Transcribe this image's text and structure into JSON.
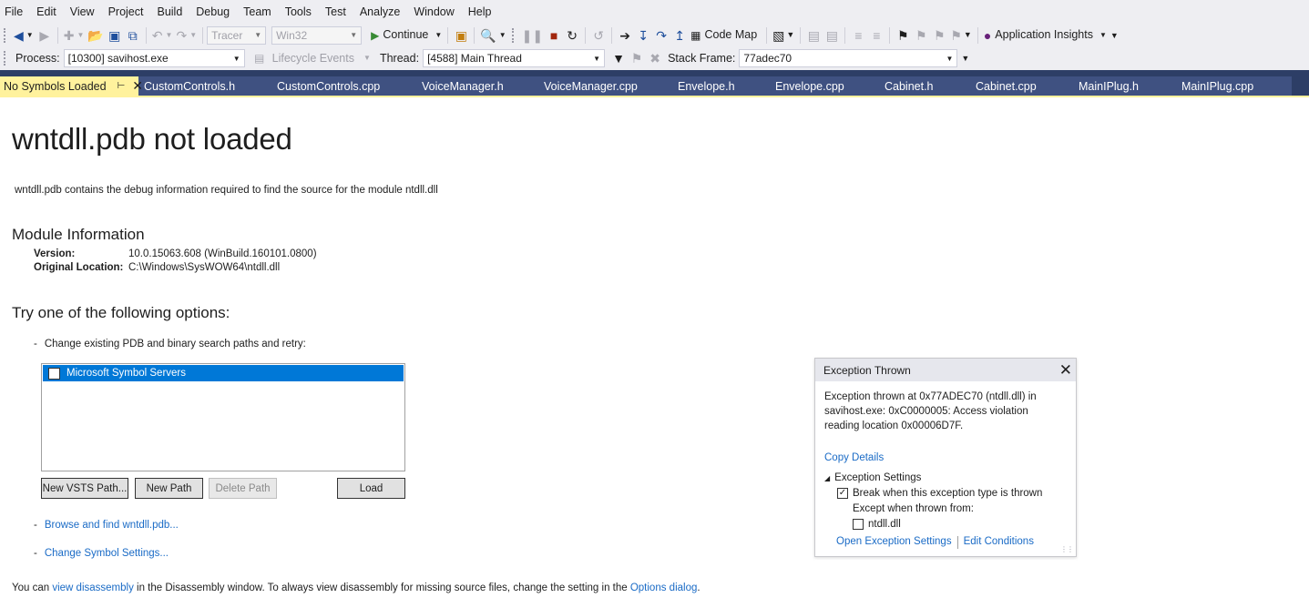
{
  "menu": [
    "File",
    "Edit",
    "View",
    "Project",
    "Build",
    "Debug",
    "Team",
    "Tools",
    "Test",
    "Analyze",
    "Window",
    "Help"
  ],
  "toolbar": {
    "config_combo": "Tracer",
    "platform_combo": "Win32",
    "continue_label": "Continue",
    "code_map_label": "Code Map",
    "app_insights_label": "Application Insights"
  },
  "debug_location": {
    "process_label": "Process:",
    "process_value": "[10300] savihost.exe",
    "lifecycle_label": "Lifecycle Events",
    "thread_label": "Thread:",
    "thread_value": "[4588] Main Thread",
    "stack_frame_label": "Stack Frame:",
    "stack_frame_value": "77adec70"
  },
  "tabs": {
    "active": "No Symbols Loaded",
    "others": [
      "CustomControls.h",
      "CustomControls.cpp",
      "VoiceManager.h",
      "VoiceManager.cpp",
      "Envelope.h",
      "Envelope.cpp",
      "Cabinet.h",
      "Cabinet.cpp",
      "MainIPlug.h",
      "MainIPlug.cpp"
    ]
  },
  "page": {
    "title": "wntdll.pdb not loaded",
    "description": "wntdll.pdb contains the debug information required to find the source for the module ntdll.dll",
    "module_heading": "Module Information",
    "version_key": "Version:",
    "version_value": "10.0.15063.608 (WinBuild.160101.0800)",
    "location_key": "Original Location:",
    "location_value": "C:\\Windows\\SysWOW64\\ntdll.dll",
    "options_heading": "Try one of the following options:",
    "option_change_paths": "Change existing PDB and binary search paths and retry:",
    "search_paths": [
      "Microsoft Symbol Servers"
    ],
    "btn_new_vsts": "New VSTS Path...",
    "btn_new_path": "New Path",
    "btn_delete_path": "Delete Path",
    "btn_load": "Load",
    "link_browse": "Browse and find wntdll.pdb...",
    "link_symbol_settings": "Change Symbol Settings...",
    "footer_pre": "You can ",
    "footer_link1": "view disassembly",
    "footer_mid": " in the Disassembly window. To always view disassembly for missing source files, change the setting in the ",
    "footer_link2": "Options dialog",
    "footer_post": "."
  },
  "exception": {
    "title": "Exception Thrown",
    "message": "Exception thrown at 0x77ADEC70 (ntdll.dll) in savihost.exe: 0xC0000005: Access violation reading location 0x00006D7F.",
    "copy_details": "Copy Details",
    "settings_heading": "Exception Settings",
    "break_when": "Break when this exception type is thrown",
    "except_when": "Except when thrown from:",
    "except_module": "ntdll.dll",
    "link_open_settings": "Open Exception Settings",
    "link_edit_conditions": "Edit Conditions"
  }
}
